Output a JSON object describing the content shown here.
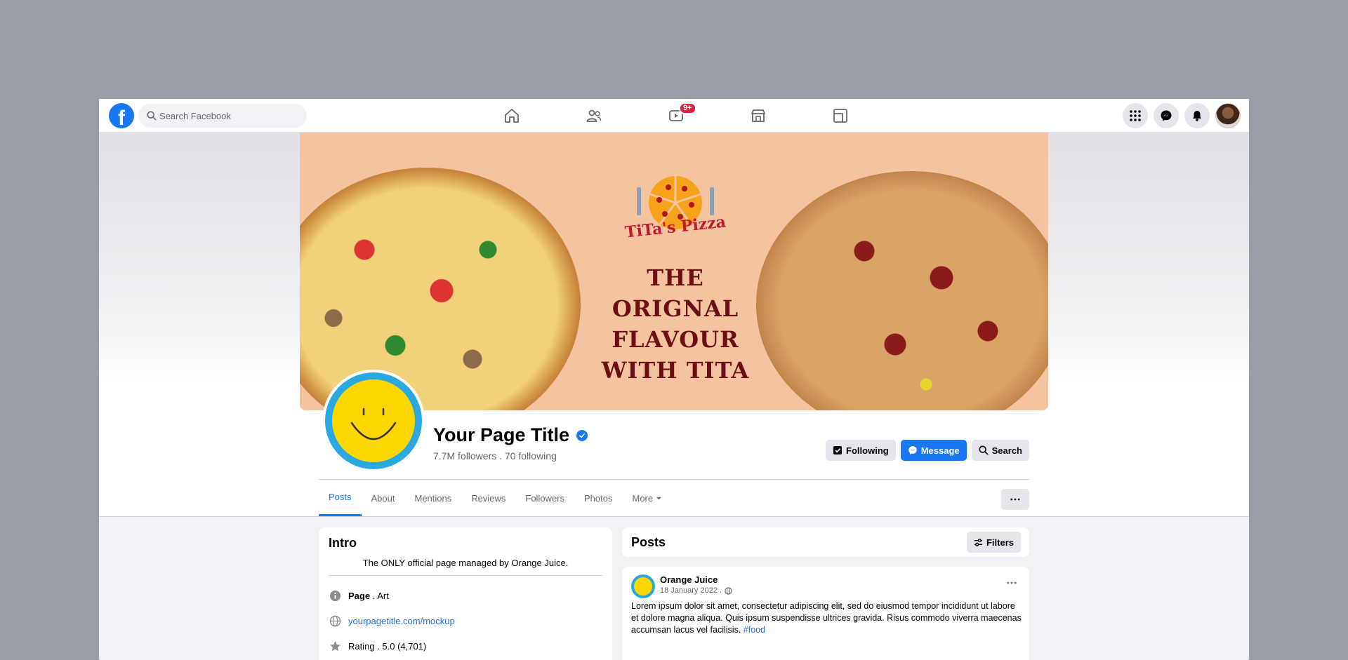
{
  "topbar": {
    "logo": "f",
    "search_placeholder": "Search Facebook",
    "watch_badge": "9+",
    "icons": [
      "home-icon",
      "friends-icon",
      "watch-icon",
      "marketplace-icon",
      "gaming-icon"
    ],
    "right_icons": [
      "menu-grid-icon",
      "messenger-icon",
      "bell-icon",
      "profile-avatar"
    ]
  },
  "cover": {
    "brand_name": "TiTa's Pizza",
    "tagline_1": "THE ORIGNAL",
    "tagline_2": "FLAVOUR",
    "tagline_3": "WITH TITA"
  },
  "profile": {
    "title": "Your Page Title",
    "stats": "7.7M followers . 70 following"
  },
  "actions": {
    "following": "Following",
    "message": "Message",
    "search": "Search"
  },
  "tabs": [
    {
      "label": "Posts"
    },
    {
      "label": "About"
    },
    {
      "label": "Mentions"
    },
    {
      "label": "Reviews"
    },
    {
      "label": "Followers"
    },
    {
      "label": "Photos"
    },
    {
      "label": "More"
    }
  ],
  "intro": {
    "heading": "Intro",
    "description": "The ONLY official page managed by Orange Juice.",
    "page_label": "Page",
    "page_category": " . Art",
    "website": "yourpagetitle.com/mockup",
    "rating": "Rating . 5.0 (4,701)"
  },
  "posts": {
    "heading": "Posts",
    "filters": "Filters",
    "author": "Orange Juice",
    "date": "18 January 2022 .",
    "text": "Lorem ipsum dolor sit amet, consectetur adipiscing elit, sed do eiusmod tempor incididunt ut labore et dolore magna aliqua. Quis ipsum suspendisse ultrices gravida. Risus commodo viverra maecenas accumsan lacus vel facilisis.",
    "hashtag": "#food"
  },
  "colors": {
    "brand_blue": "#1877f2",
    "badge_red": "#e41e3f",
    "cover_bg": "#f4c4a0",
    "profile_ring": "#29a9e1",
    "smiley": "#ffd700"
  }
}
